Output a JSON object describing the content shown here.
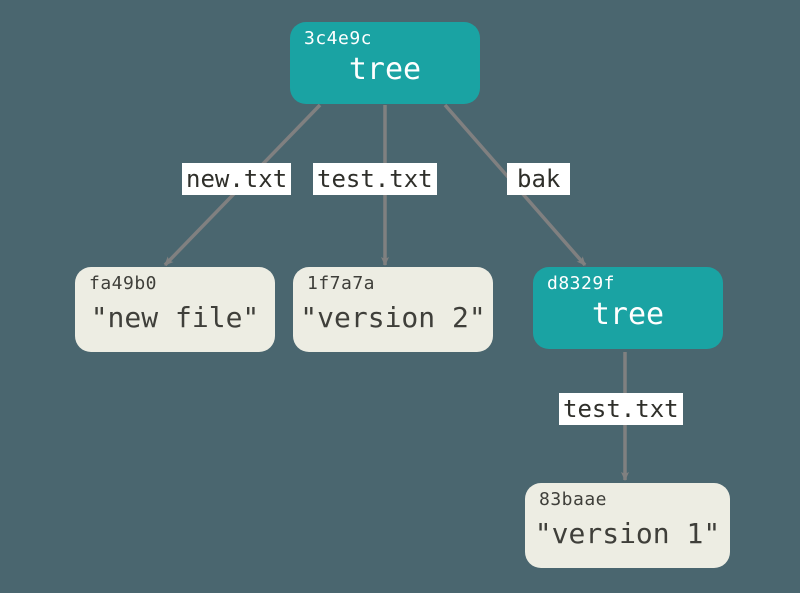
{
  "colors": {
    "background": "#4a666f",
    "tree_fill": "#1aa3a3",
    "blob_fill": "#edede3",
    "arrow": "#808080"
  },
  "nodes": {
    "root": {
      "hash": "3c4e9c",
      "label": "tree"
    },
    "blob_new": {
      "hash": "fa49b0",
      "label": "\"new file\""
    },
    "blob_v2": {
      "hash": "1f7a7a",
      "label": "\"version 2\""
    },
    "subtree": {
      "hash": "d8329f",
      "label": "tree"
    },
    "blob_v1": {
      "hash": "83baae",
      "label": "\"version 1\""
    }
  },
  "edge_labels": {
    "new_txt": "new.txt",
    "test_txt": "test.txt",
    "bak": "bak",
    "sub_test_txt": "test.txt"
  }
}
